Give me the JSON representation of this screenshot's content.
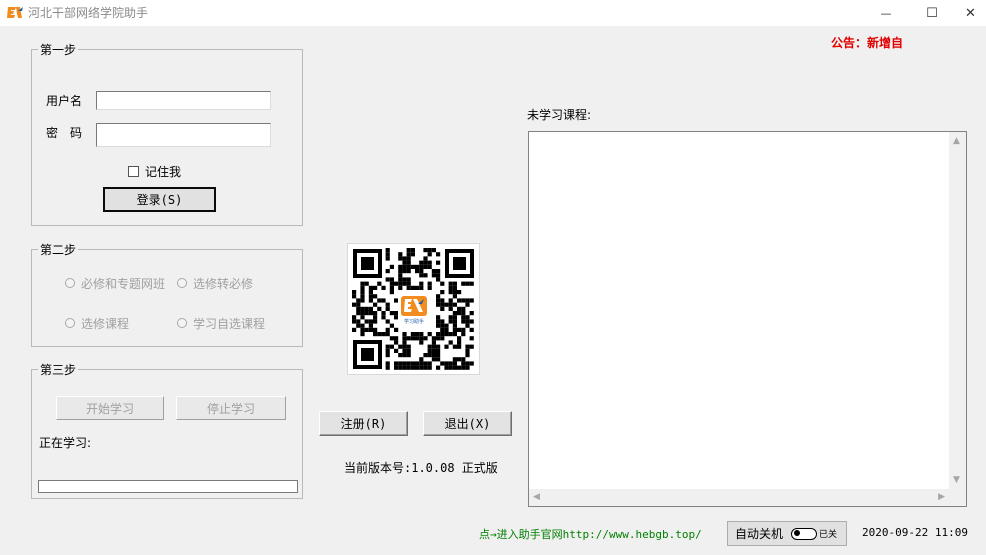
{
  "window": {
    "title": "河北干部网络学院助手",
    "minimize_glyph": "—",
    "maximize_glyph": "☐",
    "close_glyph": "✕"
  },
  "notice": "公告：新增自",
  "step1": {
    "legend": "第一步",
    "username_label": "用户名",
    "password_label": "密　码",
    "username_value": "",
    "password_value": "",
    "remember_label": "记住我",
    "login_label": "登录(S)"
  },
  "step2": {
    "legend": "第二步",
    "options": [
      "必修和专题网班",
      "选修转必修",
      "选修课程",
      "学习自选课程"
    ]
  },
  "step3": {
    "legend": "第三步",
    "start_label": "开始学习",
    "stop_label": "停止学习",
    "learning_label": "正在学习:",
    "progress": 0
  },
  "center": {
    "qr_caption": "学习助手",
    "register_label": "注册(R)",
    "exit_label": "退出(X)",
    "version": "当前版本号:1.0.08 正式版"
  },
  "right": {
    "unlearned_label": "未学习课程:"
  },
  "footer": {
    "website_link": "点→进入助手官网http://www.hebgb.top/",
    "shutdown_label": "自动关机",
    "toggle_state": "已关",
    "datetime": "2020-09-22 11:09"
  },
  "colors": {
    "notice": "#e00000",
    "link": "#008000",
    "qr_badge": "#f28c1e"
  }
}
